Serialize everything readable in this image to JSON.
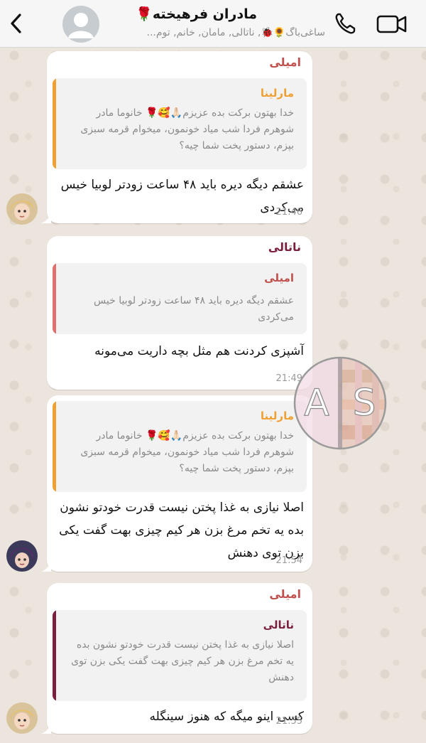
{
  "header": {
    "title": "مادران فرهیخته🌹",
    "subtitle": "ساغی‌باگ🌻🐞, ناتالی, مامان, خانم, توم..."
  },
  "colors": {
    "amily": "#c0504d",
    "marlina": "#f0a030",
    "natali": "#7a1f3d"
  },
  "messages": [
    {
      "sender": "امیلی",
      "quote": {
        "name": "مارلینا",
        "text": "خدا بهتون برکت بده عزیزم🙏🏻🥰🌹 خانوما مادر شوهرم فردا شب میاد خونمون، میخوام قرمه سبزی بپزم، دستور پخت شما چیه؟"
      },
      "text": "عشقم دیگه دیره باید ۴۸ ساعت زودتر لوبیا خیس می‌کردی",
      "time": "21:46"
    },
    {
      "sender": "ناتالی",
      "quote": {
        "name": "امیلی",
        "text": "عشقم دیگه دیره باید ۴۸ ساعت زودتر لوبیا خیس می‌کردی"
      },
      "text": "آشپزی کردنت هم مثل بچه داریت می‌مونه",
      "time": "21:49"
    },
    {
      "quote": {
        "name": "مارلینا",
        "text": "خدا بهتون برکت بده عزیزم🙏🏻🥰🌹 خانوما مادر شوهرم فردا شب میاد خونمون، میخوام قرمه سبزی بپزم، دستور پخت شما چیه؟"
      },
      "text": "اصلا نیازی به غذا پختن نیست قدرت خودتو نشون بده یه تخم مرغ بزن هر کیم چیزی بهت گفت یکی بزن توی دهنش",
      "time": "21:54"
    },
    {
      "sender": "امیلی",
      "quote": {
        "name": "ناتالی",
        "text": "اصلا نیازی به غذا پختن نیست قدرت خودتو نشون بده یه تخم مرغ بزن هر کیم چیزی بهت گفت یکی بزن توی دهنش"
      },
      "text": "کسی اینو میگه که هنوز سینگله",
      "time": "21:55"
    }
  ],
  "watermark": {
    "left": "A",
    "right": "S"
  },
  "icons": [
    "chevron-left-icon",
    "avatar-placeholder-icon",
    "phone-icon",
    "video-camera-icon"
  ]
}
